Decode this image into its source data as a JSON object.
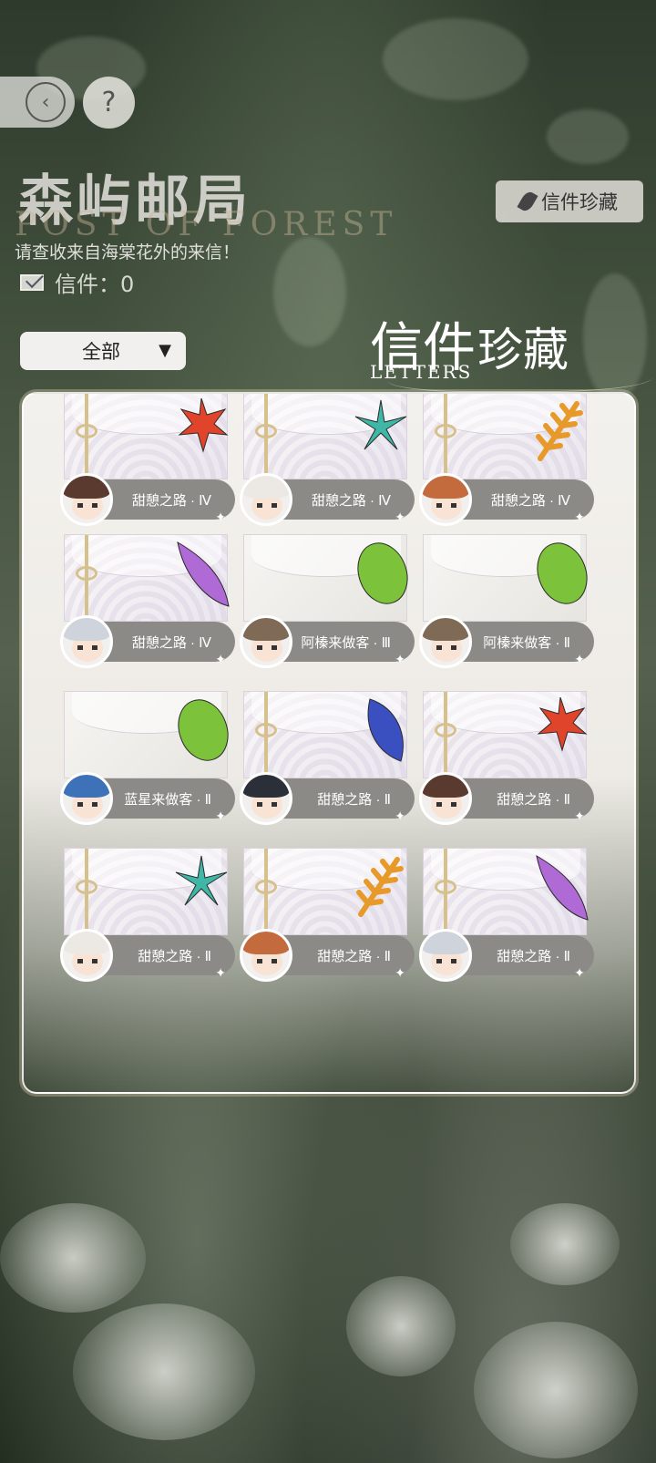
{
  "header": {
    "title": "森屿邮局",
    "subtitle_en": "POST OF FOREST",
    "tagline": "请查收来自海棠花外的来信！",
    "count_label": "信件：0"
  },
  "buttons": {
    "back_glyph": "‹",
    "help_glyph": "?",
    "collection_label": "信件珍藏"
  },
  "filter": {
    "selected": "全部",
    "arrow": "▼"
  },
  "collection_title": {
    "part1": "信件",
    "part2": "珍藏",
    "en": "LETTERS"
  },
  "letters": [
    {
      "name": "甜憩之路 · Ⅳ",
      "leaf": "maple-red",
      "style": "pattern",
      "hair": "#5a3a2e"
    },
    {
      "name": "甜憩之路 · Ⅳ",
      "leaf": "teal-star",
      "style": "pattern",
      "hair": "#ece9e4"
    },
    {
      "name": "甜憩之路 · Ⅳ",
      "leaf": "fern-orange",
      "style": "pattern",
      "hair": "#c46b3e"
    },
    {
      "name": "甜憩之路 · Ⅳ",
      "leaf": "feather-purple",
      "style": "pattern",
      "hair": "#cfd4dc"
    },
    {
      "name": "阿榛来做客 · Ⅲ",
      "leaf": "green",
      "style": "plain",
      "hair": "#7e6a55"
    },
    {
      "name": "阿榛来做客 · Ⅱ",
      "leaf": "green",
      "style": "plain",
      "hair": "#7e6a55"
    },
    {
      "name": "蓝星来做客 · Ⅱ",
      "leaf": "green",
      "style": "plain",
      "hair": "#3d72b8"
    },
    {
      "name": "甜憩之路 · Ⅱ",
      "leaf": "blue",
      "style": "pattern",
      "hair": "#2b3038"
    },
    {
      "name": "甜憩之路 · Ⅱ",
      "leaf": "maple-red",
      "style": "pattern",
      "hair": "#5a3a2e"
    },
    {
      "name": "甜憩之路 · Ⅱ",
      "leaf": "teal-star",
      "style": "pattern",
      "hair": "#ece9e4"
    },
    {
      "name": "甜憩之路 · Ⅱ",
      "leaf": "fern-orange",
      "style": "pattern",
      "hair": "#c46b3e"
    },
    {
      "name": "甜憩之路 · Ⅱ",
      "leaf": "feather-purple",
      "style": "pattern",
      "hair": "#cfd4dc"
    }
  ],
  "colors": {
    "maple-red": "#e0442a",
    "teal-star": "#3fb7a6",
    "fern-orange": "#e79a2a",
    "feather-purple": "#b06ad6",
    "green": "#7cc23a",
    "blue": "#3a4fc0"
  }
}
